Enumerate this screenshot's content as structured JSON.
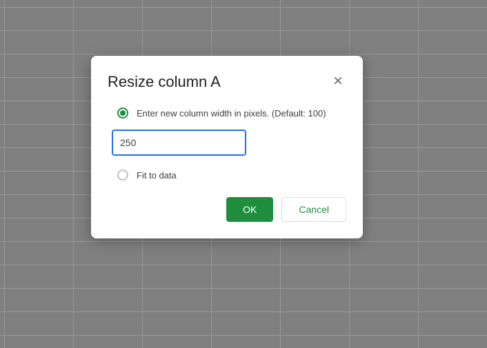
{
  "dialog": {
    "title": "Resize column A",
    "option_pixels_label": "Enter new column width in pixels. (Default: 100)",
    "width_value": "250",
    "option_fit_label": "Fit to data",
    "ok_label": "OK",
    "cancel_label": "Cancel"
  }
}
